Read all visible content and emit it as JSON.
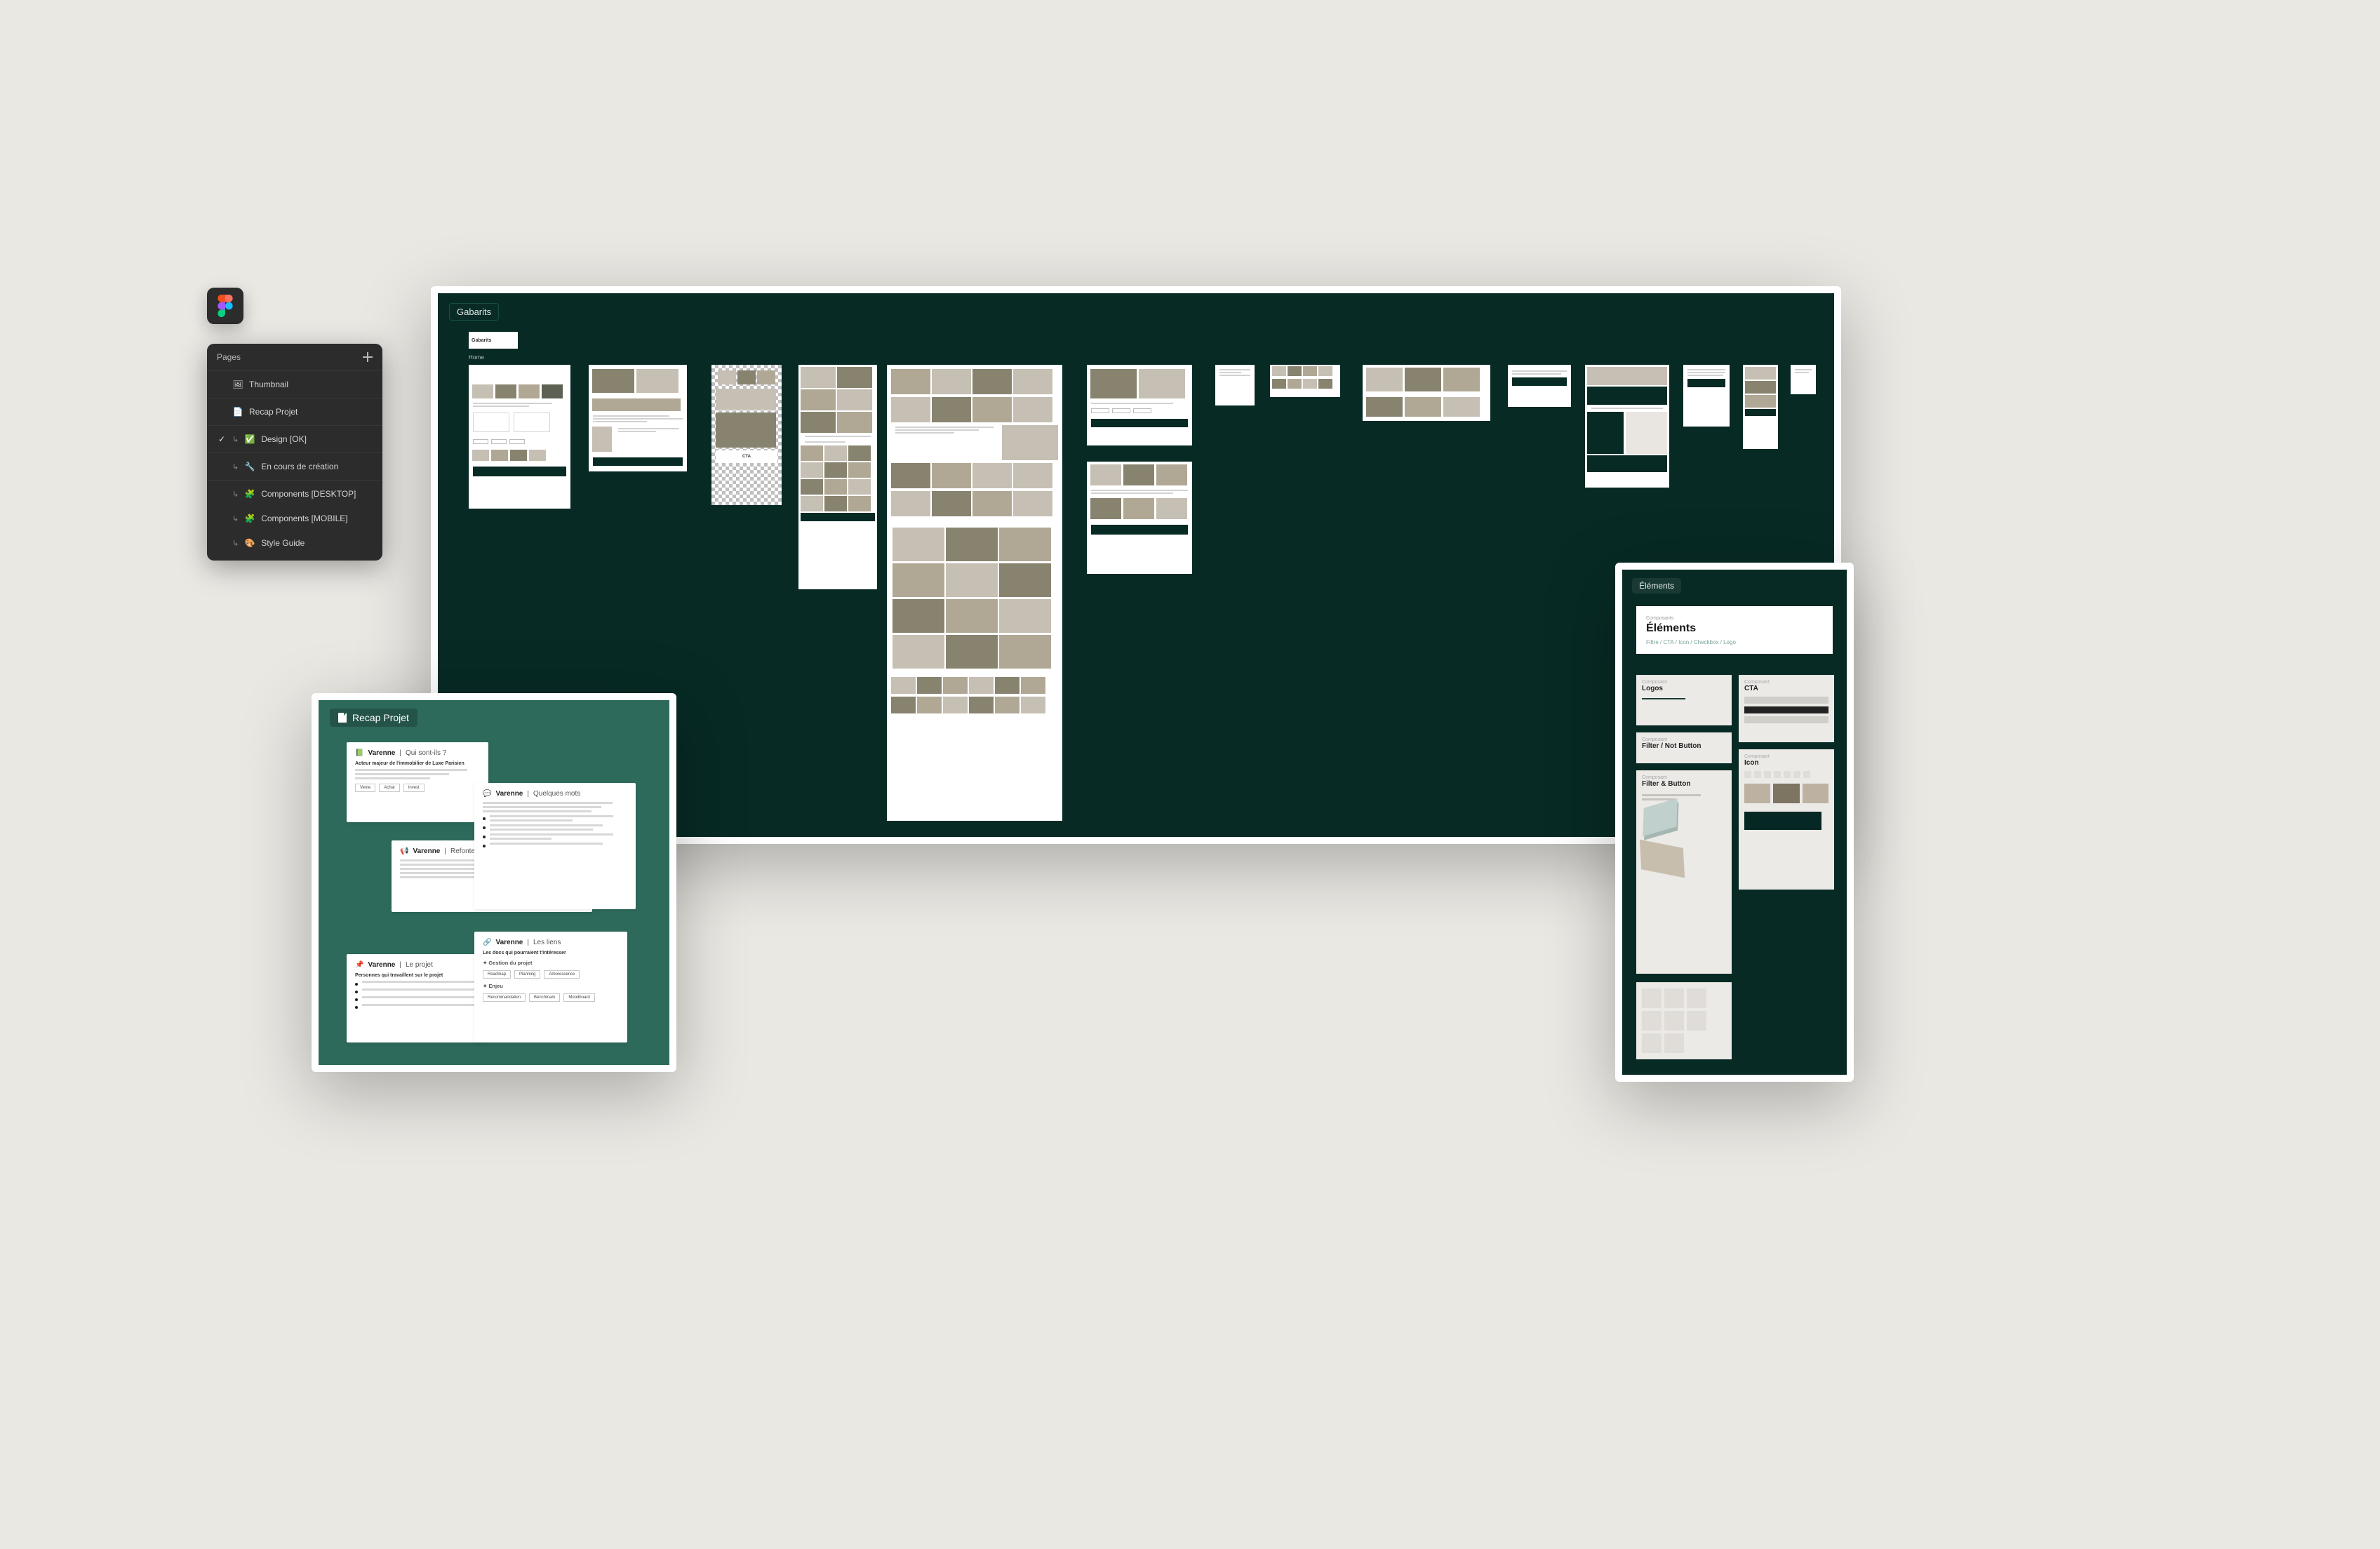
{
  "pages_panel": {
    "header": "Pages",
    "items": [
      {
        "icon": "🖼",
        "label": "Thumbnail",
        "arrow": false,
        "checked": false
      },
      {
        "icon": "📄",
        "label": "Recap Projet",
        "arrow": false,
        "checked": false
      },
      {
        "icon": "✅",
        "label": "Design [OK]",
        "arrow": true,
        "checked": true
      },
      {
        "icon": "🔧",
        "label": "En cours de création",
        "arrow": true,
        "checked": false
      },
      {
        "icon": "🧩",
        "label": "Components [DESKTOP]",
        "arrow": true,
        "checked": false
      },
      {
        "icon": "🧩",
        "label": "Components [MOBILE]",
        "arrow": true,
        "checked": false
      },
      {
        "icon": "🎨",
        "label": "Style Guide",
        "arrow": true,
        "checked": false
      }
    ],
    "separator_after": [
      0,
      1,
      2,
      3
    ]
  },
  "gabarits": {
    "tag": "Gabarits",
    "subheader": "Gabarits",
    "artboards": [
      {
        "name": "Home"
      },
      {
        "name": ""
      },
      {
        "name": ""
      },
      {
        "name": ""
      },
      {
        "name": ""
      },
      {
        "name": ""
      },
      {
        "name": ""
      },
      {
        "name": ""
      },
      {
        "name": ""
      },
      {
        "name": ""
      },
      {
        "name": ""
      },
      {
        "name": ""
      },
      {
        "name": ""
      },
      {
        "name": ""
      },
      {
        "name": ""
      }
    ]
  },
  "recap": {
    "tab": "Recap Projet",
    "cards": {
      "who": {
        "brand": "Varenne",
        "title": "Qui sont-ils ?",
        "emoji": "📗",
        "subtitle": "Acteur majeur de l'immobilier de Luxe Parisien",
        "chips": [
          "Vente",
          "Achat",
          "Invest"
        ]
      },
      "mots": {
        "brand": "Varenne",
        "title": "Quelques mots",
        "emoji": "💬"
      },
      "refonte": {
        "brand": "Varenne",
        "title": "Refonte du site",
        "emoji": "📢"
      },
      "liens": {
        "brand": "Varenne",
        "title": "Les liens",
        "emoji": "🔗",
        "link_lead": "Les docs qui pourraient t'intéresser",
        "section1": "Gestion du projet",
        "section2": "Enjeu",
        "chips1": [
          "Roadmap",
          "Planning",
          "Arborescence"
        ],
        "chips2": [
          "Recommandation",
          "Benchmark",
          "Moodboard"
        ]
      },
      "projet": {
        "brand": "Varenne",
        "title": "Le projet",
        "emoji": "📌",
        "subtitle": "Personnes qui travaillent sur le projet"
      }
    }
  },
  "elements": {
    "tag": "Éléments",
    "header": {
      "over": "Composants",
      "title": "Éléments",
      "crumb": "Filtre / CTA / Icon / Checkbox / Logo"
    },
    "panels": {
      "logos": {
        "over": "Composant",
        "title": "Logos"
      },
      "cta": {
        "over": "Composant",
        "title": "CTA"
      },
      "filter_not": {
        "over": "Composant",
        "title": "Filter / Not Button"
      },
      "filter_btn": {
        "over": "Composant",
        "title": "Filter & Button"
      },
      "icon": {
        "over": "Composant",
        "title": "Icon"
      }
    }
  }
}
